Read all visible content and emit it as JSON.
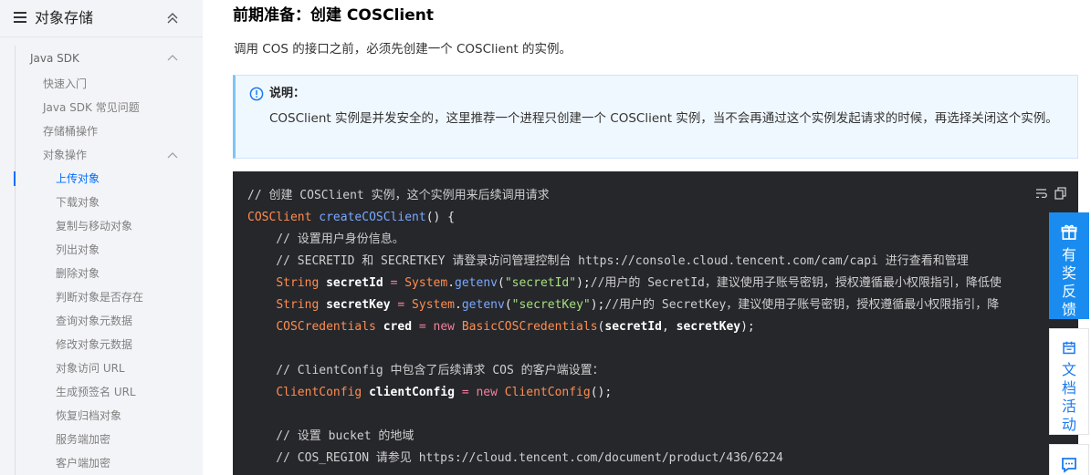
{
  "sidebar": {
    "title": "对象存储",
    "items": [
      {
        "label": "Java SDK",
        "level": 1
      },
      {
        "label": "快速入门",
        "level": 2
      },
      {
        "label": "Java SDK 常见问题",
        "level": 2
      },
      {
        "label": "存储桶操作",
        "level": 2
      },
      {
        "label": "对象操作",
        "level": 2
      },
      {
        "label": "上传对象",
        "level": 3,
        "active": true
      },
      {
        "label": "下载对象",
        "level": 3
      },
      {
        "label": "复制与移动对象",
        "level": 3
      },
      {
        "label": "列出对象",
        "level": 3
      },
      {
        "label": "删除对象",
        "level": 3
      },
      {
        "label": "判断对象是否存在",
        "level": 3
      },
      {
        "label": "查询对象元数据",
        "level": 3
      },
      {
        "label": "修改对象元数据",
        "level": 3
      },
      {
        "label": "对象访问 URL",
        "level": 3
      },
      {
        "label": "生成预签名 URL",
        "level": 3
      },
      {
        "label": "恢复归档对象",
        "level": 3
      },
      {
        "label": "服务端加密",
        "level": 3
      },
      {
        "label": "客户端加密",
        "level": 3
      }
    ]
  },
  "main": {
    "heading": "前期准备：创建 COSClient",
    "intro": "调用 COS 的接口之前，必须先创建一个 COSClient 的实例。",
    "note": {
      "label": "说明：",
      "body": "COSClient 实例是并发安全的，这里推荐一个进程只创建一个 COSClient 实例，当不会再通过这个实例发起请求的时候，再选择关闭这个实例。"
    },
    "code_lines": [
      "// 创建 COSClient 实例，这个实例用来后续调用请求",
      "COSClient createCOSClient() {",
      "    // 设置用户身份信息。",
      "    // SECRETID 和 SECRETKEY 请登录访问管理控制台 https://console.cloud.tencent.com/cam/capi 进行查看和管理",
      "    String secretId = System.getenv(\"secretId\");//用户的 SecretId，建议使用子账号密钥，授权遵循最小权限指引，降低使",
      "    String secretKey = System.getenv(\"secretKey\");//用户的 SecretKey，建议使用子账号密钥，授权遵循最小权限指引，降",
      "    COSCredentials cred = new BasicCOSCredentials(secretId, secretKey);",
      "",
      "    // ClientConfig 中包含了后续请求 COS 的客户端设置：",
      "    ClientConfig clientConfig = new ClientConfig();",
      "",
      "    // 设置 bucket 的地域",
      "    // COS_REGION 请参见 https://cloud.tencent.com/document/product/436/6224"
    ]
  },
  "float": {
    "feedback_label": "有奖反馈",
    "activity_label": "文档活动"
  }
}
